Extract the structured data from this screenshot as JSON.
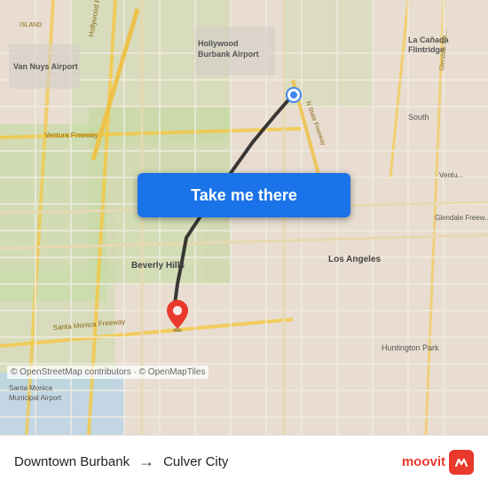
{
  "button": {
    "label": "Take me there"
  },
  "footer": {
    "origin": "Downtown Burbank",
    "destination": "Culver City",
    "moovit": "moovit",
    "attribution": "© OpenStreetMap contributors · © OpenMapTiles"
  },
  "map": {
    "bg_color": "#e8ddd0"
  }
}
